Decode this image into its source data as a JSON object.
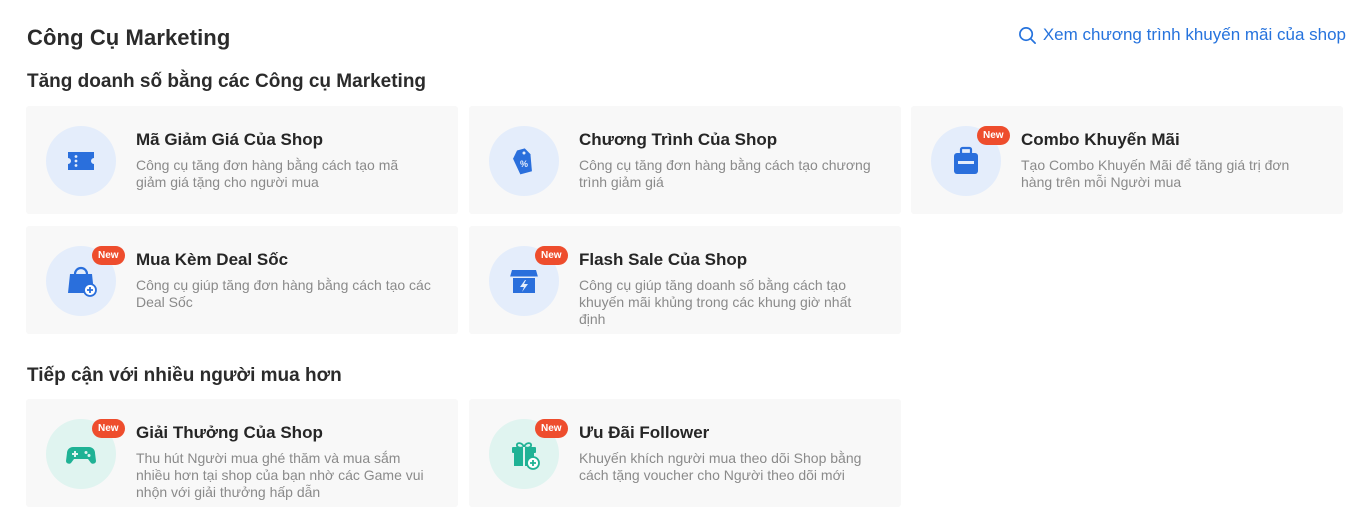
{
  "header": {
    "title": "Công Cụ Marketing",
    "promo_link": "Xem chương trình khuyến mãi của shop"
  },
  "sections": [
    {
      "title": "Tăng doanh số bằng các Công cụ Marketing",
      "cards": [
        {
          "title": "Mã Giảm Giá Của Shop",
          "desc": "Công cụ tăng đơn hàng bằng cách tạo mã giảm giá tặng cho người mua",
          "icon": "voucher-ticket-icon"
        },
        {
          "title": "Chương Trình Của Shop",
          "desc": "Công cụ tăng đơn hàng bằng cách tạo chương trình giảm giá",
          "icon": "discount-tag-icon"
        },
        {
          "title": "Combo Khuyến Mãi",
          "desc": "Tạo Combo Khuyến Mãi để tăng giá trị đơn hàng trên mỗi Người mua",
          "icon": "combo-bag-icon",
          "badge": "New"
        },
        {
          "title": "Mua Kèm Deal Sốc",
          "desc": "Công cụ giúp tăng đơn hàng bằng cách tạo các Deal Sốc",
          "icon": "add-on-bag-icon",
          "badge": "New"
        },
        {
          "title": "Flash Sale Của Shop",
          "desc": "Công cụ giúp tăng doanh số bằng cách tạo khuyến mãi khủng trong các khung giờ nhất định",
          "icon": "flash-sale-shop-icon",
          "badge": "New"
        }
      ]
    },
    {
      "title": "Tiếp cận với nhiều người mua hơn",
      "cards": [
        {
          "title": "Giải Thưởng Của Shop",
          "desc": "Thu hút Người mua ghé thăm và mua sắm nhiều hơn tại shop của bạn nhờ các Game vui nhộn với giải thưởng hấp dẫn",
          "icon": "game-controller-icon",
          "badge": "New"
        },
        {
          "title": "Ưu Đãi Follower",
          "desc": "Khuyến khích người mua theo dõi Shop bằng cách tặng voucher cho Người theo dõi mới",
          "icon": "gift-box-icon",
          "badge": "New"
        }
      ]
    }
  ],
  "colors": {
    "accent": "#2673dd",
    "icon_blue": "#2a6fdc",
    "icon_teal": "#1fb295",
    "badge": "#ee4d2d",
    "card_bg": "#f8f8f8"
  }
}
